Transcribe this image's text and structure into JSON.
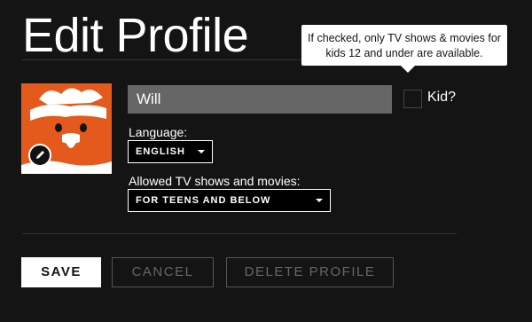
{
  "page": {
    "title": "Edit Profile"
  },
  "tooltip": {
    "text": "If checked, only TV shows & movies for kids 12 and under are available."
  },
  "profile": {
    "avatar_icon": "cartoon-chicken-avatar",
    "edit_icon": "pencil-icon",
    "name_value": "Will",
    "kid_label": "Kid?",
    "kid_checked": false
  },
  "language": {
    "label": "Language:",
    "selected": "ENGLISH"
  },
  "maturity": {
    "label": "Allowed TV shows and movies:",
    "selected": "FOR TEENS AND BELOW"
  },
  "buttons": {
    "save": "SAVE",
    "cancel": "CANCEL",
    "delete": "DELETE PROFILE"
  },
  "colors": {
    "background": "#141414",
    "avatar_bg": "#e35a1c",
    "input_bg": "#666666",
    "muted_text": "#666666"
  }
}
